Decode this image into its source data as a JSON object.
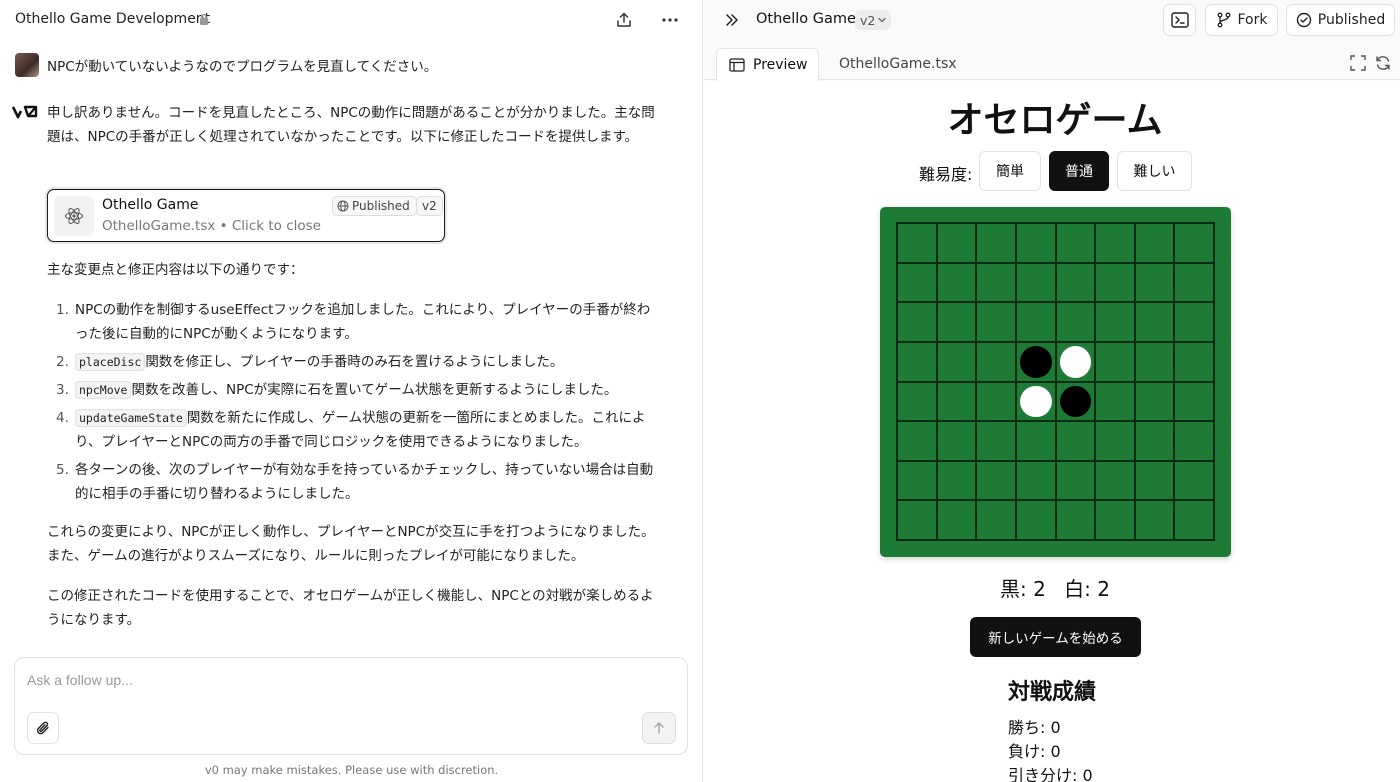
{
  "left": {
    "project_title": "Othello Game Development",
    "user_message": "NPCが動いていないようなのでプログラムを見直してください。",
    "assistant_intro": "申し訳ありません。コードを見直したところ、NPCの動作に問題があることが分かりました。主な問題は、NPCの手番が正しく処理されていなかったことです。以下に修正したコードを提供します。",
    "artifact": {
      "title": "Othello Game",
      "subtitle": "OthelloGame.tsx • Click to close",
      "status": "Published",
      "version": "v2"
    },
    "summary_heading": "主な変更点と修正内容は以下の通りです：",
    "changes": [
      {
        "num": "1.",
        "code": "",
        "text": "NPCの動作を制御するuseEffectフックを追加しました。これにより、プレイヤーの手番が終わった後に自動的にNPCが動くようになります。"
      },
      {
        "num": "2.",
        "code": "placeDisc",
        "text": "関数を修正し、プレイヤーの手番時のみ石を置けるようにしました。"
      },
      {
        "num": "3.",
        "code": "npcMove",
        "text": "関数を改善し、NPCが実際に石を置いてゲーム状態を更新するようにしました。"
      },
      {
        "num": "4.",
        "code": "updateGameState",
        "text": "関数を新たに作成し、ゲーム状態の更新を一箇所にまとめました。これにより、プレイヤーとNPCの両方の手番で同じロジックを使用できるようになりました。"
      },
      {
        "num": "5.",
        "code": "",
        "text": "各ターンの後、次のプレイヤーが有効な手を持っているかチェックし、持っていない場合は自動的に相手の手番に切り替わるようにしました。"
      }
    ],
    "result_paragraph": "これらの変更により、NPCが正しく動作し、プレイヤーとNPCが交互に手を打つようになりました。また、ゲームの進行がよりスムーズになり、ルールに則ったプレイが可能になりました。",
    "final_paragraph": "この修正されたコードを使用することで、オセロゲームが正しく機能し、NPCとの対戦が楽しめるようになります。",
    "input_placeholder": "Ask a follow up...",
    "disclaimer": "v0 may make mistakes. Please use with discretion."
  },
  "right": {
    "title": "Othello Game",
    "version": "v2",
    "fork_label": "Fork",
    "published_label": "Published",
    "tabs": {
      "preview": "Preview",
      "file": "OthelloGame.tsx"
    },
    "game": {
      "title": "オセロゲーム",
      "difficulty_label": "難易度:",
      "difficulties": [
        "簡単",
        "普通",
        "難しい"
      ],
      "selected_difficulty": "普通",
      "board": [
        [
          0,
          0,
          0,
          0,
          0,
          0,
          0,
          0
        ],
        [
          0,
          0,
          0,
          0,
          0,
          0,
          0,
          0
        ],
        [
          0,
          0,
          0,
          0,
          0,
          0,
          0,
          0
        ],
        [
          0,
          0,
          0,
          1,
          2,
          0,
          0,
          0
        ],
        [
          0,
          0,
          0,
          2,
          1,
          0,
          0,
          0
        ],
        [
          0,
          0,
          0,
          0,
          0,
          0,
          0,
          0
        ],
        [
          0,
          0,
          0,
          0,
          0,
          0,
          0,
          0
        ],
        [
          0,
          0,
          0,
          0,
          0,
          0,
          0,
          0
        ]
      ],
      "score_black": "黒: 2",
      "score_white": "白: 2",
      "new_game_label": "新しいゲームを始める",
      "record_title": "対戦成績",
      "record_win": "勝ち: 0",
      "record_lose": "負け: 0",
      "record_draw": "引き分け: 0"
    }
  },
  "colors": {
    "board_green": "#1e7b36",
    "accent_dark": "#111111"
  }
}
